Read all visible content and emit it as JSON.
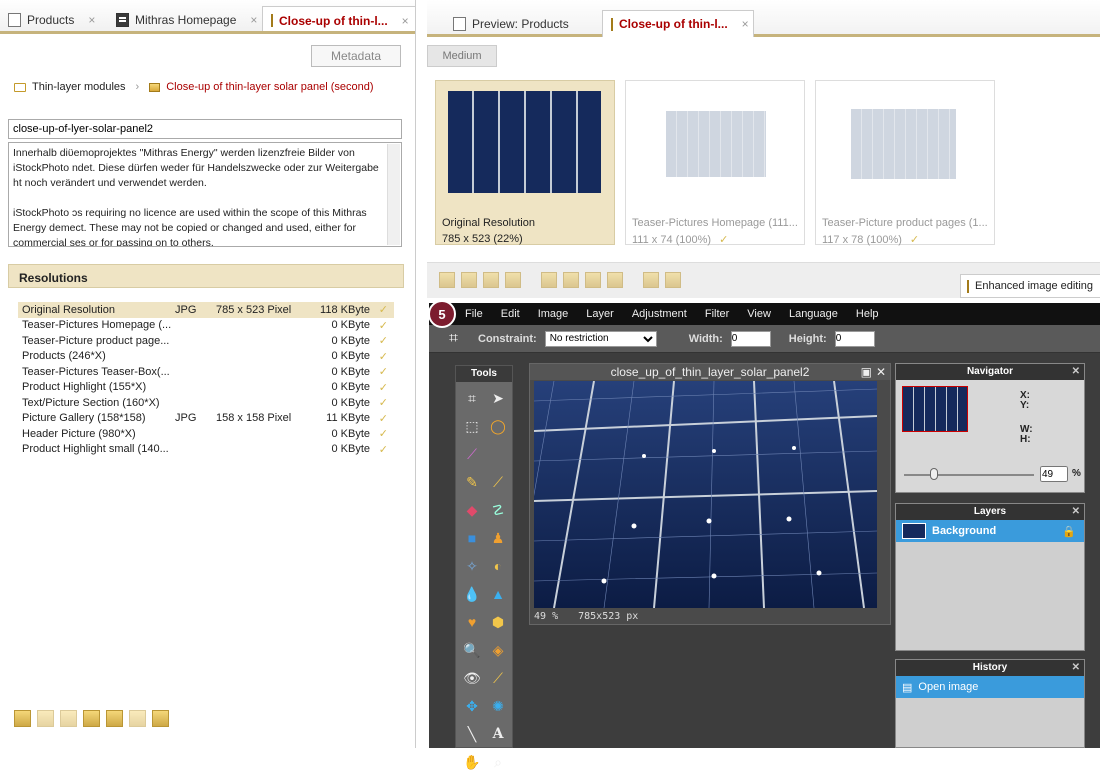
{
  "left": {
    "tabs": [
      {
        "label": "Products",
        "close": "×"
      },
      {
        "label": "Mithras Homepage",
        "close": "×"
      },
      {
        "label": "Close-up of thin-l...",
        "close": "×"
      }
    ],
    "metadata_button": "Metadata",
    "breadcrumb": {
      "folder": "Thin-layer modules",
      "separator": "›",
      "current": "Close-up of thin-layer solar panel (second)"
    },
    "name_value": "close-up-of-lyer-solar-panel2",
    "description": [
      "Innerhalb diϋemoprojektes \"Mithras Energy\" werden lizenzfreie Bilder von iStockPhoto ndet. Diese dürfen weder für Handelszwecke oder zur Weitergabe ht noch verändert und verwendet werden.",
      "iStockPhoto ɔs requiring no licence are used within the scope of this Mithras Energy demect. These may not be copied or changed and used, either for commercial ses or for passing on to others."
    ],
    "resolutions_title": "Resolutions",
    "resolutions": [
      {
        "name": "Original Resolution",
        "format": "JPG",
        "dims": "785 x 523 Pixel",
        "size": "118 KByte",
        "check": "✓"
      },
      {
        "name": "Teaser-Pictures Homepage (...",
        "format": "",
        "dims": "",
        "size": "0 KByte",
        "check": "✓"
      },
      {
        "name": "Teaser-Picture product page...",
        "format": "",
        "dims": "",
        "size": "0 KByte",
        "check": "✓"
      },
      {
        "name": "Products (246*X)",
        "format": "",
        "dims": "",
        "size": "0 KByte",
        "check": "✓"
      },
      {
        "name": "Teaser-Pictures Teaser-Box(...",
        "format": "",
        "dims": "",
        "size": "0 KByte",
        "check": "✓"
      },
      {
        "name": "Product Highlight (155*X)",
        "format": "",
        "dims": "",
        "size": "0 KByte",
        "check": "✓"
      },
      {
        "name": "Text/Picture Section (160*X)",
        "format": "",
        "dims": "",
        "size": "0 KByte",
        "check": "✓"
      },
      {
        "name": "Picture Gallery (158*158)",
        "format": "JPG",
        "dims": "158 x 158 Pixel",
        "size": "11 KByte",
        "check": "✓"
      },
      {
        "name": "Header Picture (980*X)",
        "format": "",
        "dims": "",
        "size": "0 KByte",
        "check": "✓"
      },
      {
        "name": "Product Highlight small (140...",
        "format": "",
        "dims": "",
        "size": "0 KByte",
        "check": "✓"
      }
    ]
  },
  "right": {
    "tabs": [
      {
        "label": "Preview: Products"
      },
      {
        "label": "Close-up of thin-l...",
        "close": "×"
      }
    ],
    "medium_button": "Medium",
    "thumbs": [
      {
        "label": "Original Resolution",
        "dims": "785 x 523 (22%)",
        "check": ""
      },
      {
        "label": "Teaser-Pictures Homepage (111...",
        "dims": "111 x 74 (100%)",
        "check": "✓"
      },
      {
        "label": "Teaser-Picture product pages (1...",
        "dims": "117 x 78 (100%)",
        "check": "✓"
      }
    ],
    "enhanced_label": "Enhanced image editing",
    "enhanced_close": "×"
  },
  "editor": {
    "step_badge": "5",
    "menu": [
      "File",
      "Edit",
      "Image",
      "Layer",
      "Adjustment",
      "Filter",
      "View",
      "Language",
      "Help"
    ],
    "constraint_label": "Constraint:",
    "constraint_value": "No restriction",
    "width_label": "Width:",
    "width_value": "0",
    "height_label": "Height:",
    "height_value": "0",
    "tools_title": "Tools",
    "canvas_title": "close_up_of_thin_layer_solar_panel2",
    "zoom": "49",
    "zoom_unit": "%",
    "canvas_size": "785x523 px",
    "navigator_title": "Navigator",
    "nav_x": "X:",
    "nav_y": "Y:",
    "nav_w": "W:",
    "nav_h": "H:",
    "nav_zoom": "49",
    "nav_zoom_unit": "%",
    "layers_title": "Layers",
    "layer_name": "Background",
    "history_title": "History",
    "history_item": "Open image",
    "panel_close": "✕"
  }
}
